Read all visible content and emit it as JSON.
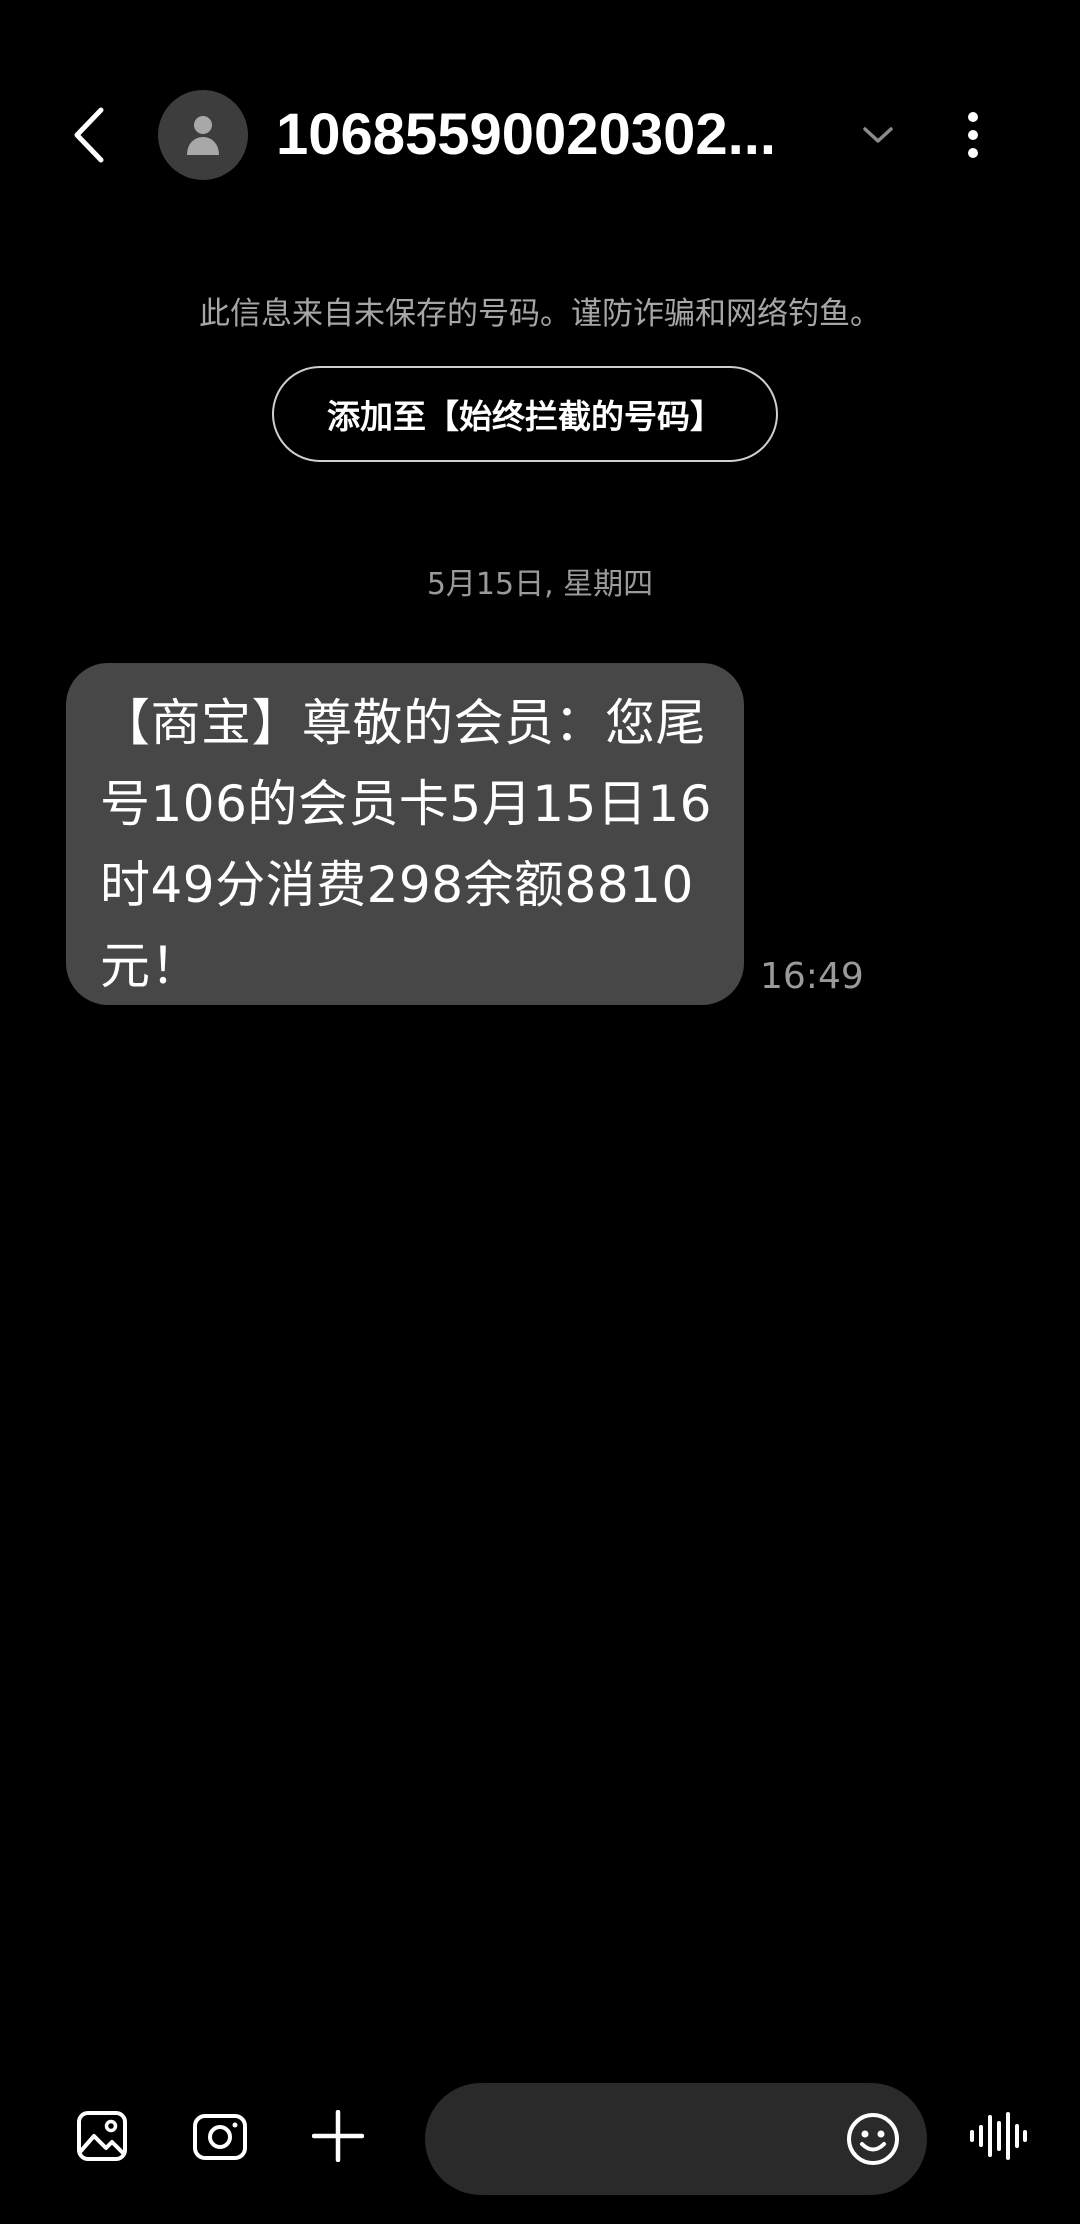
{
  "header": {
    "contact_number": "10685590020302...",
    "icons": {
      "back": "back-arrow-icon",
      "avatar": "person-icon",
      "expand": "chevron-down-icon",
      "more": "more-vertical-icon"
    }
  },
  "warning": {
    "text": "此信息来自未保存的号码。谨防诈骗和网络钓鱼。",
    "block_button_label": "添加至【始终拦截的号码】"
  },
  "conversation": {
    "date_separator": "5月15日, 星期四",
    "messages": [
      {
        "text": "【商宝】尊敬的会员：您尾号106的会员卡5月15日16时49分消费298余额8810元！",
        "time": "16:49",
        "direction": "incoming"
      }
    ]
  },
  "composer": {
    "placeholder": "",
    "icons": {
      "gallery": "gallery-icon",
      "camera": "camera-icon",
      "add": "plus-icon",
      "emoji": "emoji-icon",
      "voice": "voice-waveform-icon"
    }
  },
  "colors": {
    "background": "#000000",
    "bubble": "#474747",
    "input": "#2a2a2a",
    "secondary_text": "#9a9a9a"
  }
}
